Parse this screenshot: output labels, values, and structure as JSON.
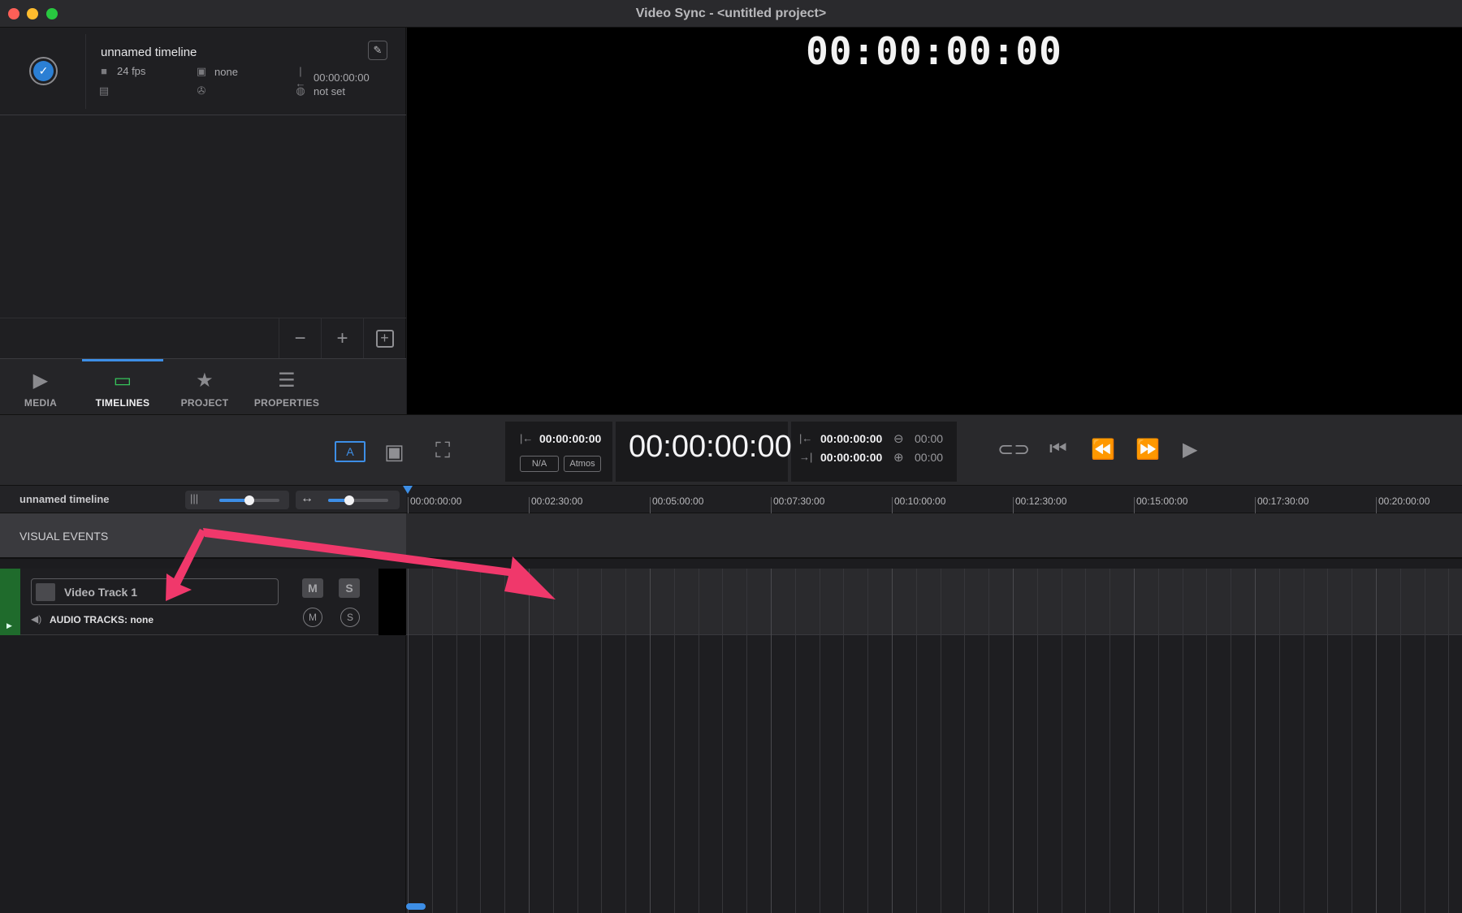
{
  "window": {
    "title": "Video Sync - <untitled project>"
  },
  "timeline_item": {
    "name": "unnamed timeline",
    "fps": "24 fps",
    "format": "none",
    "start_tc": "00:00:00:00",
    "region": "not set"
  },
  "tabs": [
    {
      "label": "MEDIA",
      "icon": "media-icon"
    },
    {
      "label": "TIMELINES",
      "icon": "timeline-icon"
    },
    {
      "label": "PROJECT",
      "icon": "project-file-icon"
    },
    {
      "label": "PROPERTIES",
      "icon": "list-icon"
    }
  ],
  "viewer": {
    "timecode": "00:00:00:00"
  },
  "transport": {
    "in_tc": "00:00:00:00",
    "na_label": "N/A",
    "atmos_label": "Atmos",
    "main_tc": "00:00:00:00",
    "range_in_tc": "00:00:00:00",
    "range_out_tc": "00:00:00:00",
    "offset_minus": "00:00",
    "offset_plus": "00:00",
    "a_label": "A"
  },
  "timeline": {
    "header_name": "unnamed timeline",
    "ruler_labels": [
      "00:00:00:00",
      "00:02:30:00",
      "00:05:00:00",
      "00:07:30:00",
      "00:10:00:00",
      "00:12:30:00",
      "00:15:00:00",
      "00:17:30:00",
      "00:20:00:00"
    ],
    "visual_events_label": "VISUAL EVENTS",
    "waveform_zoom": 0.5,
    "horizontal_zoom": 0.35
  },
  "track": {
    "name": "Video Track 1",
    "audio_tracks": "AUDIO TRACKS: none",
    "mute_label": "M",
    "solo_label": "S",
    "color": "#1f6b2c"
  },
  "colors": {
    "accent": "#3d8ee6",
    "active_tab_icon": "#36c25a",
    "annotation_arrow": "#f0386b"
  }
}
